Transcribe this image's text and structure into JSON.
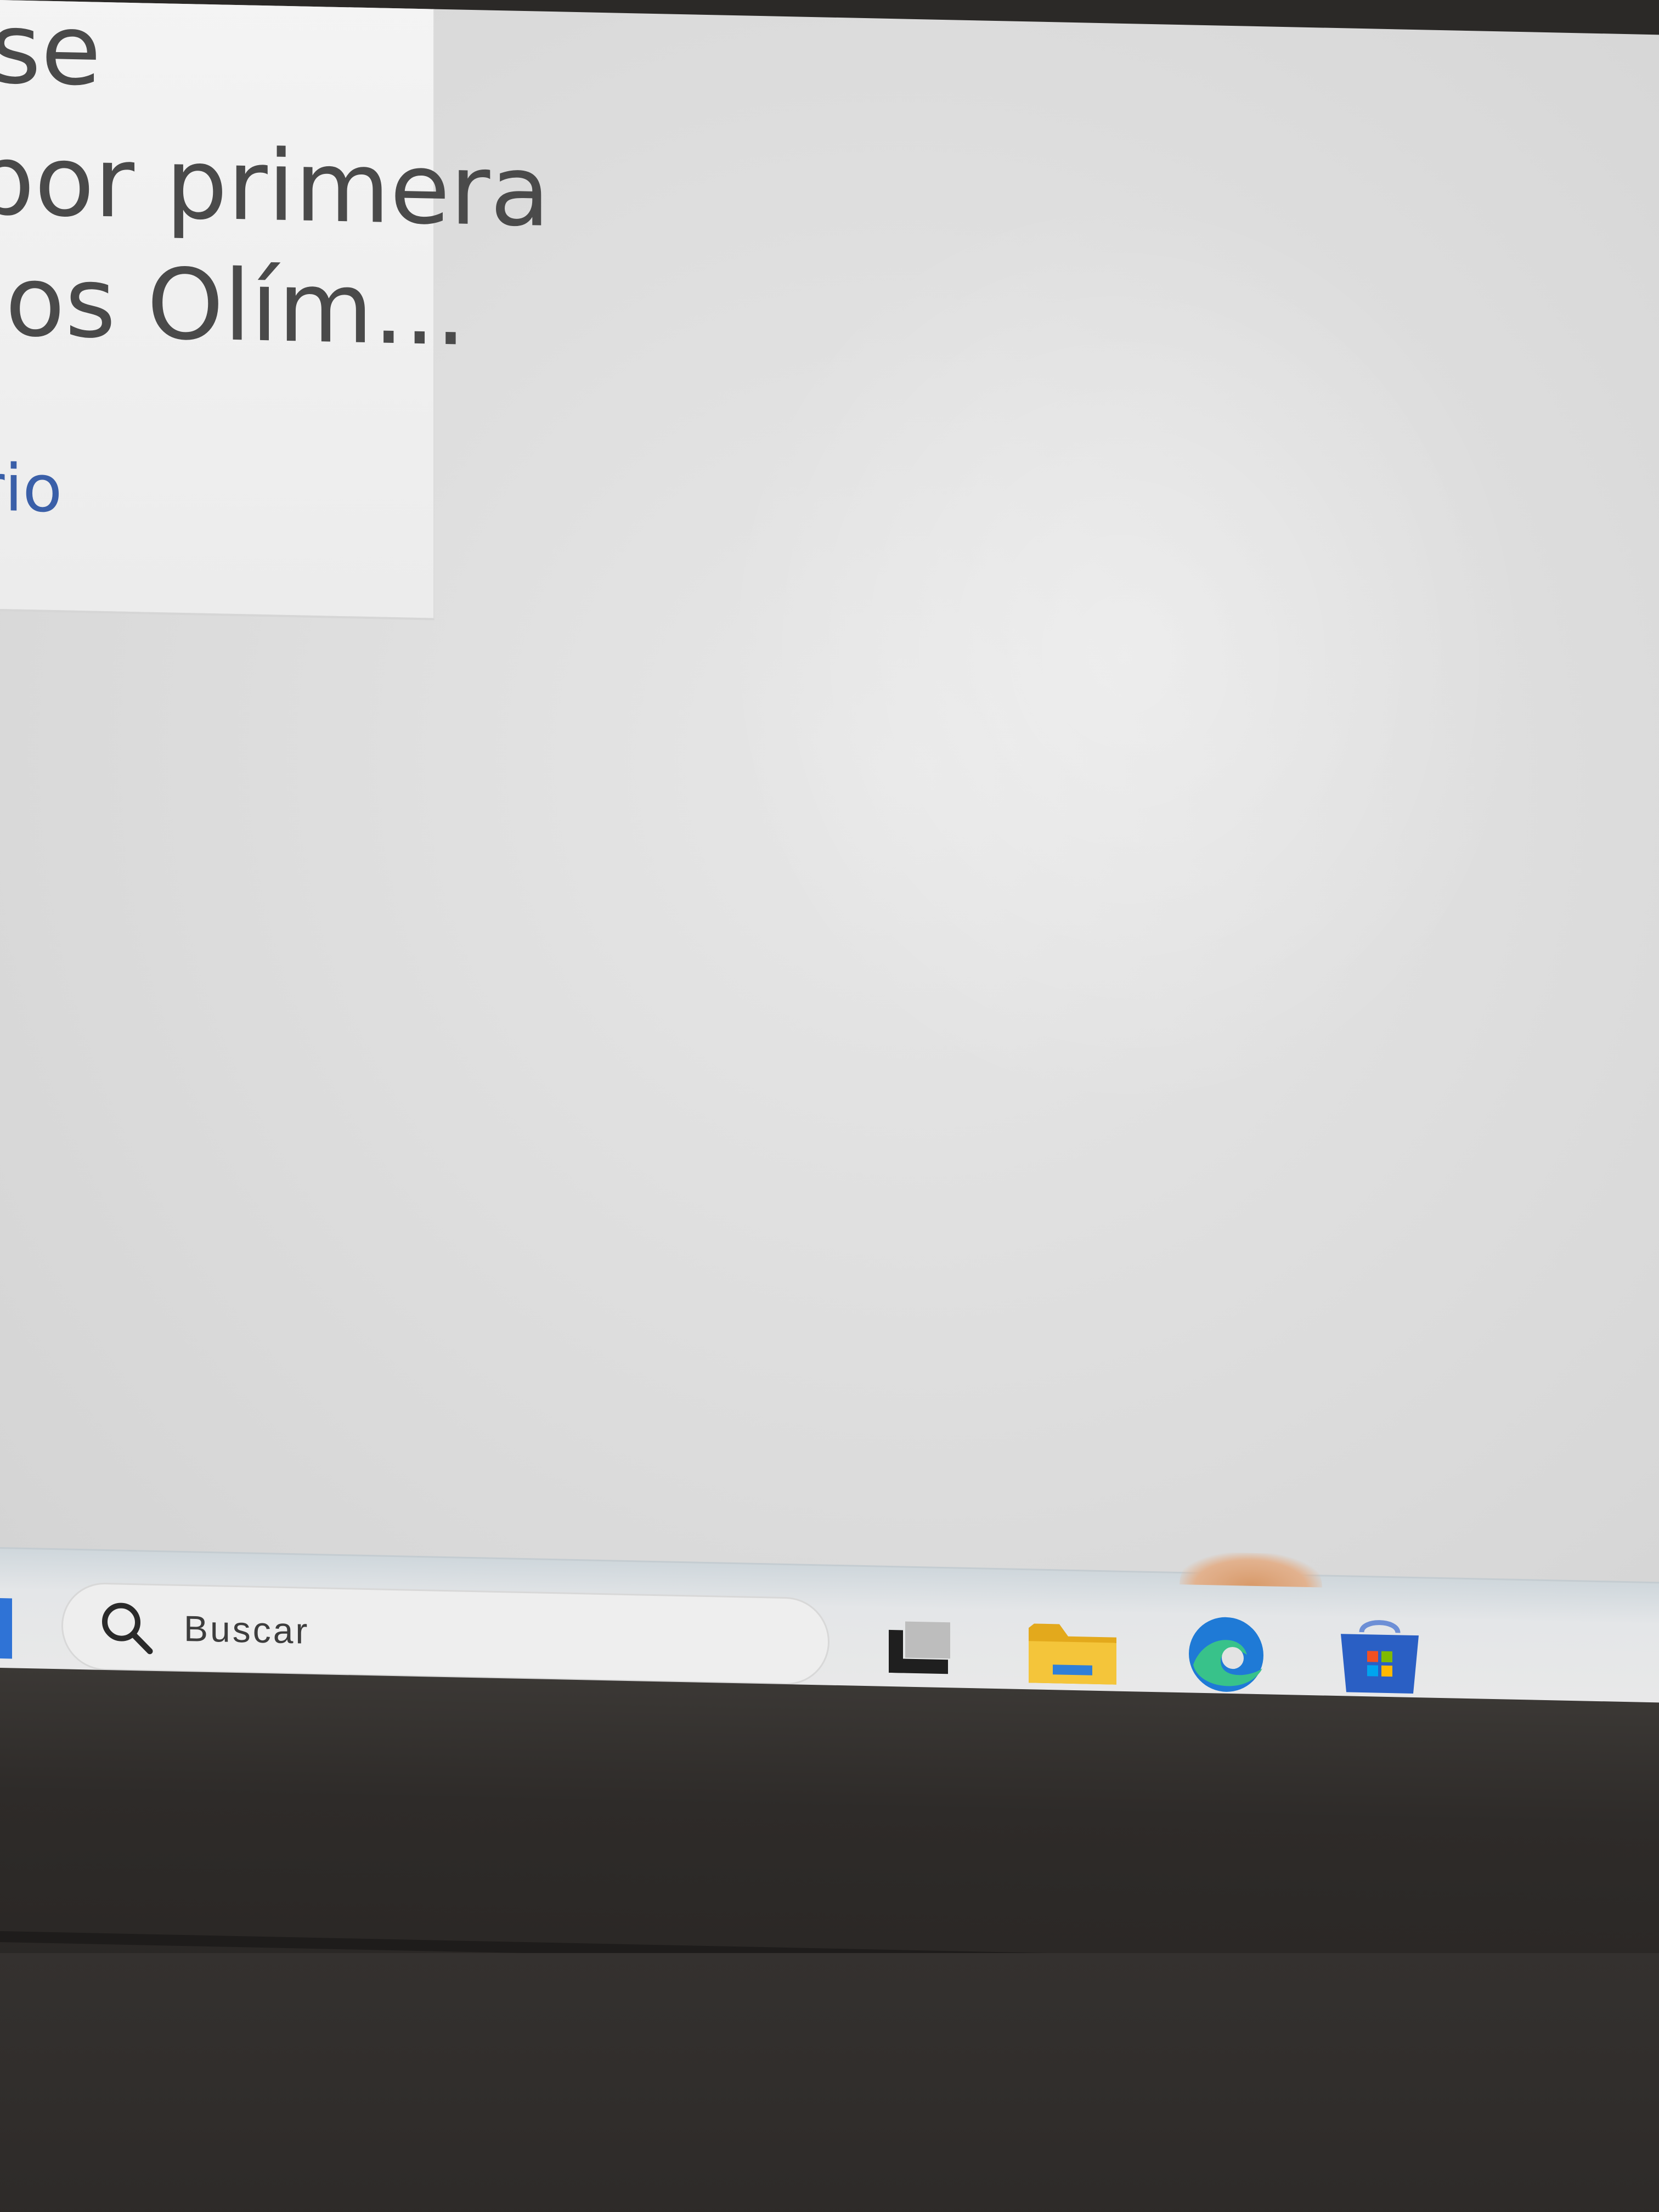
{
  "article": {
    "headline_lines": [
      "se",
      "por primera",
      "jos Olím..."
    ],
    "meta_link": "rio"
  },
  "taskbar": {
    "search": {
      "placeholder": "Buscar"
    },
    "pinned_apps": [
      {
        "name": "task-view-icon"
      },
      {
        "name": "file-explorer-icon"
      },
      {
        "name": "edge-browser-icon"
      },
      {
        "name": "microsoft-store-icon"
      }
    ]
  },
  "colors": {
    "screen_bg": "#e3e3e3",
    "headline_text": "#4a4a4a",
    "link_text": "#3a5fa8",
    "taskbar_bg": "#e6e6e6",
    "folder_yellow": "#f2c12e",
    "edge_blue": "#1f7ad6",
    "edge_green": "#38c28a",
    "store_blue": "#2a5fc4",
    "bezel": "#2e2b29"
  }
}
